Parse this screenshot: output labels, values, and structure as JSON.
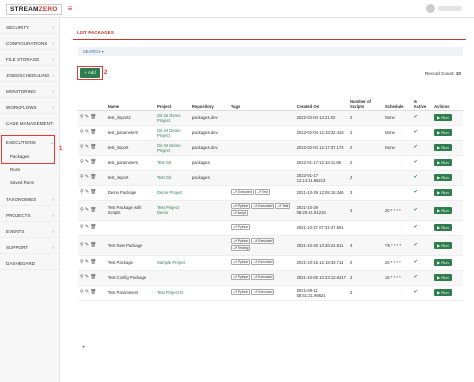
{
  "app": {
    "logo_main": "STREAM",
    "logo_accent": "ZERO",
    "menu_icon": "hamburger-icon"
  },
  "sidebar": {
    "items": [
      {
        "label": "SECURITY"
      },
      {
        "label": "CONFIGURATIONS"
      },
      {
        "label": "FILE STORAGE"
      },
      {
        "label": "JOBS/SCHEDULING"
      },
      {
        "label": "MONITORING"
      },
      {
        "label": "WORKFLOWS"
      },
      {
        "label": "CASE MANAGEMENT"
      },
      {
        "label": "EXECUTIONS"
      },
      {
        "label": "TAXONOMIES"
      },
      {
        "label": "PROJECTS"
      },
      {
        "label": "EVENTS"
      },
      {
        "label": "SUPPORT"
      },
      {
        "label": "DASHBOARD"
      }
    ],
    "sub_items": [
      {
        "label": "Packages"
      },
      {
        "label": "Runs"
      },
      {
        "label": "Saved Runs"
      }
    ],
    "annotation": "1"
  },
  "page": {
    "title": "LIST PACKAGES",
    "search_label": "SEARCH ▾",
    "add_label": "+ Add",
    "add_annotation": "2",
    "record_count_label": "Record Count:",
    "record_count_value": "10",
    "add_row_label": "+"
  },
  "table": {
    "headers": [
      "",
      "Name",
      "Project",
      "Repository",
      "Tags",
      "Created On",
      "Number of Scripts",
      "Schedule",
      "Is Active",
      "Actions"
    ],
    "run_label": "▶ Run",
    "rows": [
      {
        "name": "test_import2",
        "project": "Git Int Demo Project",
        "repo": "packages.dev",
        "tags": [],
        "created": "2022-02-04 13:21:02",
        "scripts": "2",
        "schedule": "None"
      },
      {
        "name": "test_parameters",
        "project": "Git Int Demo Project",
        "repo": "packages.dev",
        "tags": [],
        "created": "2022-02-04 12:18:32.443",
        "scripts": "2",
        "schedule": "None"
      },
      {
        "name": "test_import",
        "project": "Git Int Demo Project",
        "repo": "packages.dev",
        "tags": [],
        "created": "2022-02-04 12:17:37.174",
        "scripts": "2",
        "schedule": "None"
      },
      {
        "name": "test_parameters",
        "project": "Test Git",
        "repo": "packages",
        "tags": [],
        "created": "2022-01-17 12:16:11.86",
        "scripts": "2",
        "schedule": ""
      },
      {
        "name": "test_import",
        "project": "Test Git",
        "repo": "packages",
        "tags": [],
        "created": "2022-01-17 12:14:11.86213",
        "scripts": "2",
        "schedule": ""
      },
      {
        "name": "Demo Package",
        "project": "Demo Project",
        "repo": "",
        "tags": [
          "Executed",
          "Test"
        ],
        "created": "2021-10-29 12:05:15.346",
        "scripts": "3",
        "schedule": ""
      },
      {
        "name": "Test Package with Scripts",
        "project": "Test Project Demo",
        "repo": "",
        "tags": [
          "Python",
          "Executed",
          "Test",
          "script"
        ],
        "created": "2021-10-29 08:28:41.91215",
        "scripts": "4",
        "schedule": "20 * * * *"
      },
      {
        "name": "",
        "project": "",
        "repo": "",
        "tags": [
          "Python"
        ],
        "created": "2021-10-27 07:31:47.591",
        "scripts": "",
        "schedule": ""
      },
      {
        "name": "Test New Package",
        "project": "",
        "repo": "",
        "tags": [
          "Python",
          "Executed",
          "Testing"
        ],
        "created": "2021-10-26 13:26:24.611",
        "scripts": "3",
        "schedule": "*/5 * * * *"
      },
      {
        "name": "Test Package",
        "project": "Sample Project",
        "repo": "",
        "tags": [
          "Python",
          "Executed"
        ],
        "created": "2021-10-15 12:19:33.711",
        "scripts": "2",
        "schedule": "20 * * * *"
      },
      {
        "name": "Test Config Package",
        "project": "",
        "repo": "",
        "tags": [
          "Python",
          "Executed"
        ],
        "created": "2021-10-05 10:23:12.8417",
        "scripts": "2",
        "schedule": "15 * * * *"
      },
      {
        "name": "Test Parameters",
        "project": "Test Project N",
        "repo": "",
        "tags": [
          "Python",
          "Executed"
        ],
        "created": "2021-08-11 08:51:21.98621",
        "scripts": "3",
        "schedule": ""
      }
    ]
  }
}
